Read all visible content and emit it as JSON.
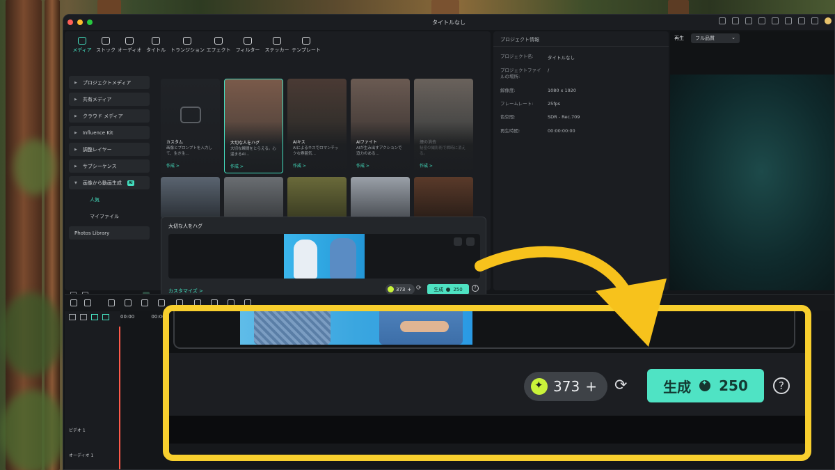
{
  "window": {
    "title": "タイトルなし"
  },
  "toolbar_tabs": [
    {
      "label": "メディア",
      "icon": "media-icon",
      "active": true
    },
    {
      "label": "ストック",
      "icon": "stock-icon"
    },
    {
      "label": "オーディオ",
      "icon": "music-icon"
    },
    {
      "label": "タイトル",
      "icon": "title-icon"
    },
    {
      "label": "トランジション",
      "icon": "transition-icon"
    },
    {
      "label": "エフェクト",
      "icon": "effect-icon"
    },
    {
      "label": "フィルター",
      "icon": "filter-icon"
    },
    {
      "label": "ステッカー",
      "icon": "sticker-icon"
    },
    {
      "label": "テンプレート",
      "icon": "template-icon"
    }
  ],
  "sidebar": {
    "items": [
      {
        "label": "プロジェクトメディア"
      },
      {
        "label": "共有メディア"
      },
      {
        "label": "クラウド メディア"
      },
      {
        "label": "Influence Kit"
      },
      {
        "label": "調整レイヤー"
      },
      {
        "label": "サブシーケンス"
      },
      {
        "label": "画像から動画生成",
        "badge": "AI"
      }
    ],
    "subitems": [
      {
        "label": "人気",
        "active": true
      },
      {
        "label": "マイファイル"
      }
    ],
    "photos": "Photos Library"
  },
  "cards": [
    {
      "title": "カスタム",
      "desc": "画像とプロンプトを入力して、生き生…",
      "cta": "作成 >"
    },
    {
      "title": "大切な人をハグ",
      "desc": "大切な瞬間をとらえる。心温まるAI…",
      "cta": "作成 >"
    },
    {
      "title": "AIキス",
      "desc": "AIによるキスでロマンチックな雰囲気…",
      "cta": "作成 >"
    },
    {
      "title": "AIファイト",
      "desc": "AIが生み出すアクションで迫力のある…",
      "cta": "作成 >"
    },
    {
      "title": "煙の消去",
      "desc": "秘密の撮影術で瞬時に消える。",
      "cta": "作成 >"
    }
  ],
  "popup": {
    "title": "大切な人をハグ",
    "customize": "カスタマイズ >",
    "credits": "373",
    "generate_label": "生成",
    "generate_cost": "250"
  },
  "project_info": {
    "header": "プロジェクト情報",
    "rows": [
      {
        "k": "プロジェクト名:",
        "v": "タイトルなし"
      },
      {
        "k": "プロジェクトファイルの場所:",
        "v": "/"
      },
      {
        "k": "解像度:",
        "v": "1080 x 1920"
      },
      {
        "k": "フレームレート:",
        "v": "25fps"
      },
      {
        "k": "色空間:",
        "v": "SDR - Rec.709"
      },
      {
        "k": "再生時間:",
        "v": "00:00:00:00"
      }
    ]
  },
  "player": {
    "label": "再生",
    "quality": "フル品質"
  },
  "timeline": {
    "ruler": [
      "00:00",
      "00:00"
    ],
    "video_track": "ビデオ 1",
    "audio_track": "オーディオ 1"
  },
  "zoom": {
    "credits": "373",
    "plus": "+",
    "generate_label": "生成",
    "generate_cost": "250",
    "help": "?"
  },
  "colors": {
    "accent": "#44e0c0",
    "callout_border": "#f8cf2e",
    "arrow": "#f7c21c",
    "credit_icon": "#c8f23a"
  }
}
